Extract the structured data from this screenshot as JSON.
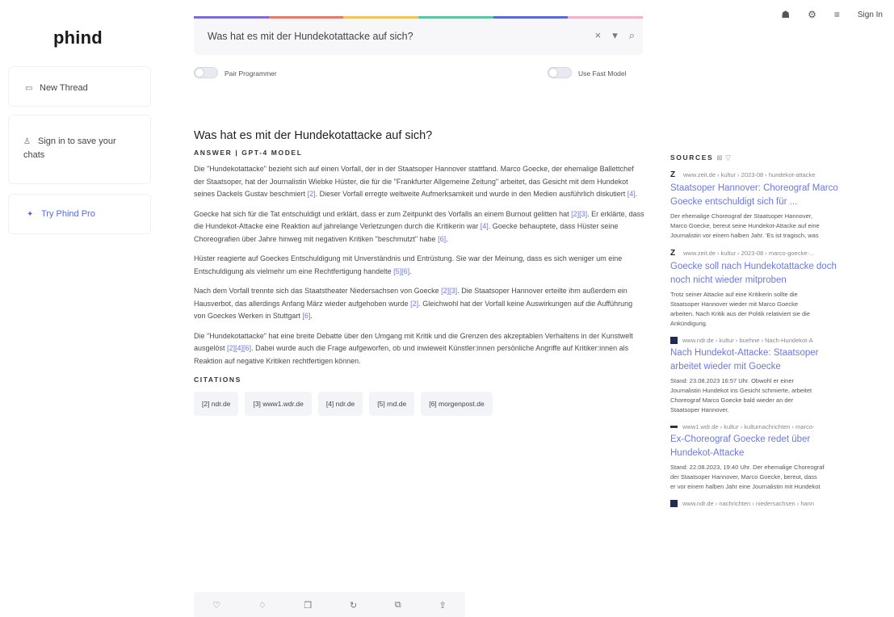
{
  "app": {
    "logo": "phind"
  },
  "sidebar": {
    "new_thread": "New Thread",
    "sign_in": "Sign in to save your chats",
    "try_pro": "Try Phind Pro"
  },
  "header": {
    "sign_in": "Sign In"
  },
  "search": {
    "query": "Was hat es mit der Hundekotattacke auf sich?",
    "toggle_pair_programmer": "Pair Programmer",
    "toggle_fast_model": "Use Fast Model"
  },
  "answer": {
    "title": "Was hat es mit der Hundekotattacke auf sich?",
    "model_label": "ANSWER | GPT-4 MODEL",
    "p1": {
      "text": "Die \"Hundekotattacke\" bezieht sich auf einen Vorfall, der in der Staatsoper Hannover stattfand. Marco Goecke, der ehemalige Ballettchef der Staatsoper, hat der Journalistin Wiebke Hüster, die für die \"Frankfurter Allgemeine Zeitung\" arbeitet, das Gesicht mit dem Hundekot seines Dackels Gustav beschmiert ",
      "r1": "[2]",
      "mid": ". Dieser Vorfall erregte weltweite Aufmerksamkeit und wurde in den Medien ausführlich diskutiert ",
      "r2": "[4]",
      "end": "."
    },
    "p2": {
      "text": "Goecke hat sich für die Tat entschuldigt und erklärt, dass er zum Zeitpunkt des Vorfalls an einem Burnout gelitten hat ",
      "r1": "[2][3]",
      "mid": ". Er erklärte, dass die Hundekot-Attacke eine Reaktion auf jahrelange Verletzungen durch die Kritikerin war ",
      "r2": "[4]",
      "mid2": ". Goecke behauptete, dass Hüster seine Choreografien über Jahre hinweg mit negativen Kritiken \"beschmutzt\" habe ",
      "r3": "[6]",
      "end": "."
    },
    "p3": {
      "text": "Hüster reagierte auf Goeckes Entschuldigung mit Unverständnis und Entrüstung. Sie war der Meinung, dass es sich weniger um eine Entschuldigung als vielmehr um eine Rechtfertigung handelte ",
      "r1": "[5][6]",
      "end": "."
    },
    "p4": {
      "text": "Nach dem Vorfall trennte sich das Staatstheater Niedersachsen von Goecke ",
      "r1": "[2][3]",
      "mid": ". Die Staatsoper Hannover erteilte ihm außerdem ein Hausverbot, das allerdings Anfang März wieder aufgehoben wurde ",
      "r2": "[2]",
      "mid2": ". Gleichwohl hat der Vorfall keine Auswirkungen auf die Aufführung von Goeckes Werken in Stuttgart ",
      "r3": "[6]",
      "end": "."
    },
    "p5": {
      "text": "Die \"Hundekotattacke\" hat eine breite Debatte über den Umgang mit Kritik und die Grenzen des akzeptablen Verhaltens in der Kunstwelt ausgelöst ",
      "r1": "[2][4][6]",
      "mid": ". Dabei wurde auch die Frage aufgeworfen, ob und inwieweit Künstler:innen persönliche Angriffe auf Kritiker:innen als Reaktion auf negative Kritiken rechtfertigen können."
    },
    "citations_label": "CITATIONS",
    "citations": [
      "[2] ndr.de",
      "[3] www1.wdr.de",
      "[4] ndr.de",
      "[5] rnd.de",
      "[6] morgenpost.de"
    ]
  },
  "sources": {
    "label": "SOURCES",
    "items": [
      {
        "url": "www.zeit.de › kultur › 2023-08 › hundekot-attacke",
        "title_lines": [
          "Staatsoper Hannover: Choreograf Marco",
          "Goecke entschuldigt sich für ..."
        ],
        "snippet_lines": [
          "Der ehemalige Choreograf der Staatsoper Hannover,",
          "Marco Goecke, bereut seine Hundekot-Attacke auf eine",
          "Journalistin vor einem halben Jahr. 'Es ist tragisch, was"
        ]
      },
      {
        "url": "www.zeit.de › kultur › 2023-08 › marco-goecke-...",
        "title_lines": [
          "Goecke soll nach Hundekotattacke doch",
          "noch nicht wieder mitproben"
        ],
        "snippet_lines": [
          "Trotz seiner Attacke auf eine Kritikerin sollte die",
          "Staatsoper Hannover wieder mit Marco Goecke",
          "arbeiten. Nach Kritik aus der Politik relativiert sie die",
          "Ankündigung."
        ]
      },
      {
        "url": "www.ndr.de › kultur › buehne › Nach-Hundekot-A",
        "title_lines": [
          "Nach Hundekot-Attacke: Staatsoper",
          "arbeitet wieder mit Goecke"
        ],
        "snippet_lines": [
          "Stand: 23.08.2023 16:57 Uhr. Obwohl er einer",
          "Journalistin Hundekot ins Gesicht schmierte, arbeitet",
          "Choreograf Marco Goecke bald wieder an der",
          "Staatsoper Hannover."
        ]
      },
      {
        "url": "www1.wdr.de › kultur › kulturnachrichten › marco-",
        "title_lines": [
          "Ex-Choreograf Goecke redet über",
          "Hundekot-Attacke"
        ],
        "snippet_lines": [
          "Stand: 22.08.2023, 19:40 Uhr. Der ehemalige Choreograf",
          "der Staatsoper Hannover, Marco Goecke, bereut, dass",
          "er vor einem halben Jahr eine Journalistin mit Hundekot"
        ]
      },
      {
        "url": "www.ndr.de › nachrichten › niedersachsen › hann",
        "title_lines": [],
        "snippet_lines": []
      }
    ]
  },
  "colors": {
    "accent": "#6b78e0",
    "rainbow": [
      "#7e6ad8",
      "#e27d6d",
      "#f2c55c",
      "#5dc6a0",
      "#5b6ad8",
      "#f3b3c6"
    ]
  },
  "icons": [
    "discord-icon",
    "settings-icon",
    "menu-icon",
    "chat-icon",
    "user-icon",
    "sparkle-icon",
    "close-icon",
    "chevron-down-icon",
    "search-icon",
    "filter-icon",
    "thumbs-up-icon",
    "thumbs-down-icon",
    "copy-icon",
    "regenerate-icon",
    "share-icon",
    "export-icon"
  ]
}
